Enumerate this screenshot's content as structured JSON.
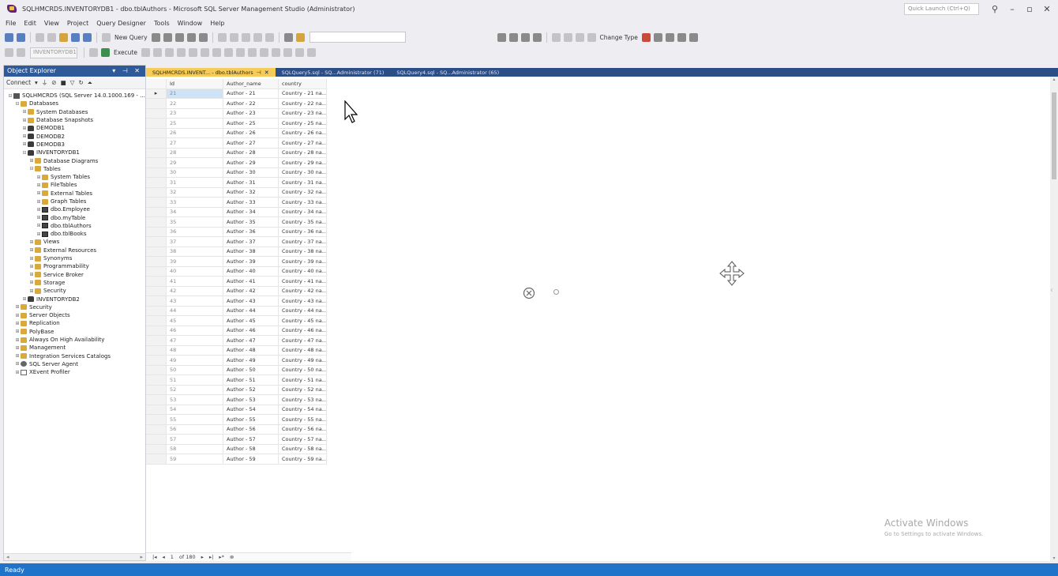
{
  "titlebar": {
    "title": "SQLHMCRDS.INVENTORYDB1 - dbo.tblAuthors - Microsoft SQL Server Management Studio (Administrator)",
    "quick_launch": "Quick Launch (Ctrl+Q)"
  },
  "menu": [
    "File",
    "Edit",
    "View",
    "Project",
    "Query Designer",
    "Tools",
    "Window",
    "Help"
  ],
  "toolbar": {
    "new_query": "New Query",
    "change_type": "Change Type",
    "execute": "Execute",
    "db_dropdown": "INVENTORYDB1"
  },
  "object_explorer": {
    "title": "Object Explorer",
    "connect": "Connect",
    "nodes": [
      {
        "label": "SQLHMCRDS (SQL Server 14.0.1000.169 - ...",
        "level": 0,
        "icon": "server-icon",
        "exp": "⊟"
      },
      {
        "label": "Databases",
        "level": 1,
        "icon": "folder-icon",
        "exp": "⊟"
      },
      {
        "label": "System Databases",
        "level": 2,
        "icon": "folder-icon",
        "exp": "⊞"
      },
      {
        "label": "Database Snapshots",
        "level": 2,
        "icon": "folder-icon",
        "exp": "⊞"
      },
      {
        "label": "DEMODB1",
        "level": 2,
        "icon": "database-icon",
        "exp": "⊞"
      },
      {
        "label": "DEMODB2",
        "level": 2,
        "icon": "database-icon",
        "exp": "⊞"
      },
      {
        "label": "DEMODB3",
        "level": 2,
        "icon": "database-icon",
        "exp": "⊞"
      },
      {
        "label": "INVENTORYDB1",
        "level": 2,
        "icon": "database-icon",
        "exp": "⊟"
      },
      {
        "label": "Database Diagrams",
        "level": 3,
        "icon": "folder-icon",
        "exp": "⊞"
      },
      {
        "label": "Tables",
        "level": 3,
        "icon": "folder-icon",
        "exp": "⊟"
      },
      {
        "label": "System Tables",
        "level": 4,
        "icon": "folder-icon",
        "exp": "⊞"
      },
      {
        "label": "FileTables",
        "level": 4,
        "icon": "folder-icon",
        "exp": "⊞"
      },
      {
        "label": "External Tables",
        "level": 4,
        "icon": "folder-icon",
        "exp": "⊞"
      },
      {
        "label": "Graph Tables",
        "level": 4,
        "icon": "folder-icon",
        "exp": "⊞"
      },
      {
        "label": "dbo.Employee",
        "level": 4,
        "icon": "table-icon",
        "exp": "⊞"
      },
      {
        "label": "dbo.myTable",
        "level": 4,
        "icon": "table-icon",
        "exp": "⊞"
      },
      {
        "label": "dbo.tblAuthors",
        "level": 4,
        "icon": "table-icon",
        "exp": "⊞"
      },
      {
        "label": "dbo.tblBooks",
        "level": 4,
        "icon": "table-icon",
        "exp": "⊞"
      },
      {
        "label": "Views",
        "level": 3,
        "icon": "folder-icon",
        "exp": "⊞"
      },
      {
        "label": "External Resources",
        "level": 3,
        "icon": "folder-icon",
        "exp": "⊞"
      },
      {
        "label": "Synonyms",
        "level": 3,
        "icon": "folder-icon",
        "exp": "⊞"
      },
      {
        "label": "Programmability",
        "level": 3,
        "icon": "folder-icon",
        "exp": "⊞"
      },
      {
        "label": "Service Broker",
        "level": 3,
        "icon": "folder-icon",
        "exp": "⊞"
      },
      {
        "label": "Storage",
        "level": 3,
        "icon": "folder-icon",
        "exp": "⊞"
      },
      {
        "label": "Security",
        "level": 3,
        "icon": "folder-icon",
        "exp": "⊞"
      },
      {
        "label": "INVENTORYDB2",
        "level": 2,
        "icon": "database-icon",
        "exp": "⊞"
      },
      {
        "label": "Security",
        "level": 1,
        "icon": "folder-icon",
        "exp": "⊞"
      },
      {
        "label": "Server Objects",
        "level": 1,
        "icon": "folder-icon",
        "exp": "⊞"
      },
      {
        "label": "Replication",
        "level": 1,
        "icon": "folder-icon",
        "exp": "⊞"
      },
      {
        "label": "PolyBase",
        "level": 1,
        "icon": "folder-icon",
        "exp": "⊞"
      },
      {
        "label": "Always On High Availability",
        "level": 1,
        "icon": "folder-icon",
        "exp": "⊞"
      },
      {
        "label": "Management",
        "level": 1,
        "icon": "folder-icon",
        "exp": "⊞"
      },
      {
        "label": "Integration Services Catalogs",
        "level": 1,
        "icon": "folder-icon",
        "exp": "⊞"
      },
      {
        "label": "SQL Server Agent",
        "level": 1,
        "icon": "agent-icon",
        "exp": "⊞"
      },
      {
        "label": "XEvent Profiler",
        "level": 1,
        "icon": "xevent-icon",
        "exp": "⊞"
      }
    ]
  },
  "tabs": [
    {
      "label": "SQLHMCRDS.INVENT... - dbo.tblAuthors",
      "active": true
    },
    {
      "label": "SQLQuery5.sql - SQ...Administrator (71)",
      "active": false
    },
    {
      "label": "SQLQuery4.sql - SQ...Administrator (65)",
      "active": false
    }
  ],
  "grid": {
    "columns": [
      "Id",
      "Author_name",
      "country"
    ],
    "rows": [
      [
        "21",
        "Author - 21",
        "Country - 21 na..."
      ],
      [
        "22",
        "Author - 22",
        "Country - 22 na..."
      ],
      [
        "23",
        "Author - 23",
        "Country - 23 na..."
      ],
      [
        "25",
        "Author - 25",
        "Country - 25 na..."
      ],
      [
        "26",
        "Author - 26",
        "Country - 26 na..."
      ],
      [
        "27",
        "Author - 27",
        "Country - 27 na..."
      ],
      [
        "28",
        "Author - 28",
        "Country - 28 na..."
      ],
      [
        "29",
        "Author - 29",
        "Country - 29 na..."
      ],
      [
        "30",
        "Author - 30",
        "Country - 30 na..."
      ],
      [
        "31",
        "Author - 31",
        "Country - 31 na..."
      ],
      [
        "32",
        "Author - 32",
        "Country - 32 na..."
      ],
      [
        "33",
        "Author - 33",
        "Country - 33 na..."
      ],
      [
        "34",
        "Author - 34",
        "Country - 34 na..."
      ],
      [
        "35",
        "Author - 35",
        "Country - 35 na..."
      ],
      [
        "36",
        "Author - 36",
        "Country - 36 na..."
      ],
      [
        "37",
        "Author - 37",
        "Country - 37 na..."
      ],
      [
        "38",
        "Author - 38",
        "Country - 38 na..."
      ],
      [
        "39",
        "Author - 39",
        "Country - 39 na..."
      ],
      [
        "40",
        "Author - 40",
        "Country - 40 na..."
      ],
      [
        "41",
        "Author - 41",
        "Country - 41 na..."
      ],
      [
        "42",
        "Author - 42",
        "Country - 42 na..."
      ],
      [
        "43",
        "Author - 43",
        "Country - 43 na..."
      ],
      [
        "44",
        "Author - 44",
        "Country - 44 na..."
      ],
      [
        "45",
        "Author - 45",
        "Country - 45 na..."
      ],
      [
        "46",
        "Author - 46",
        "Country - 46 na..."
      ],
      [
        "47",
        "Author - 47",
        "Country - 47 na..."
      ],
      [
        "48",
        "Author - 48",
        "Country - 48 na..."
      ],
      [
        "49",
        "Author - 49",
        "Country - 49 na..."
      ],
      [
        "50",
        "Author - 50",
        "Country - 50 na..."
      ],
      [
        "51",
        "Author - 51",
        "Country - 51 na..."
      ],
      [
        "52",
        "Author - 52",
        "Country - 52 na..."
      ],
      [
        "53",
        "Author - 53",
        "Country - 53 na..."
      ],
      [
        "54",
        "Author - 54",
        "Country - 54 na..."
      ],
      [
        "55",
        "Author - 55",
        "Country - 55 na..."
      ],
      [
        "56",
        "Author - 56",
        "Country - 56 na..."
      ],
      [
        "57",
        "Author - 57",
        "Country - 57 na..."
      ],
      [
        "58",
        "Author - 58",
        "Country - 58 na..."
      ],
      [
        "59",
        "Author - 59",
        "Country - 59 na..."
      ]
    ]
  },
  "nav": {
    "current": "1",
    "of": "of 180"
  },
  "watermark": {
    "line1": "Activate Windows",
    "line2": "Go to Settings to activate Windows."
  },
  "status": "Ready",
  "colors": {
    "accent": "#2b4e86",
    "tab_active": "#f5cc5a",
    "status_bar": "#1f73c8",
    "selection": "#cfe3f7"
  }
}
